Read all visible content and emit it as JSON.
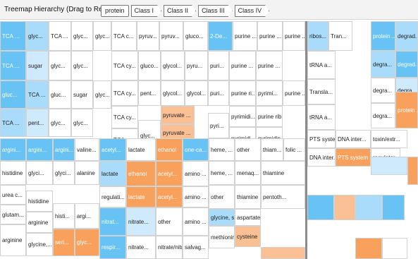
{
  "header": {
    "title": "Treemap Hierarchy (Drag to Reorder)",
    "breadcrumbs": [
      "protein",
      "Class I",
      "Class II",
      "Class III",
      "Class IV"
    ]
  },
  "treemap": {
    "cells": [
      {
        "label": "TCA ...",
        "c": "b1"
      },
      {
        "label": "glyc...",
        "c": "b2"
      },
      {
        "label": "TCA ...",
        "c": "w"
      },
      {
        "label": "glyc...",
        "c": "w"
      },
      {
        "label": "glyc...",
        "c": "w"
      },
      {
        "label": "TCA c...",
        "c": "w"
      },
      {
        "label": "pyruv...",
        "c": "w"
      },
      {
        "label": "pyruv...",
        "c": "w"
      },
      {
        "label": "gluco...",
        "c": "w"
      },
      {
        "label": "2-De...",
        "c": "b1"
      },
      {
        "label": "purine ...",
        "c": "w"
      },
      {
        "label": "purine ...",
        "c": "w"
      },
      {
        "label": "purine ...",
        "c": "w"
      },
      {
        "label": "ribos...",
        "c": "b2"
      },
      {
        "label": "Tran...",
        "c": "w"
      },
      {
        "label": "protein ...",
        "c": "b1"
      },
      {
        "label": "degrad...",
        "c": "b2"
      },
      {
        "label": "TCA ...",
        "c": "b1"
      },
      {
        "label": "sugar",
        "c": "b3"
      },
      {
        "label": "glyc...",
        "c": "w"
      },
      {
        "label": "glyc...",
        "c": "w"
      },
      {
        "label": "TCA cy...",
        "c": "w"
      },
      {
        "label": "gluco...",
        "c": "w"
      },
      {
        "label": "glycol...",
        "c": "w"
      },
      {
        "label": "pyru...",
        "c": "w"
      },
      {
        "label": "puri...",
        "c": "w"
      },
      {
        "label": "purine ...",
        "c": "w"
      },
      {
        "label": "purine ...",
        "c": "w"
      },
      {
        "label": "tRNA a...",
        "c": "w"
      },
      {
        "label": "degra...",
        "c": "b2"
      },
      {
        "label": "degrad...",
        "c": "b1"
      },
      {
        "label": "gluc...",
        "c": "b1"
      },
      {
        "label": "TCA ...",
        "c": "b2"
      },
      {
        "label": "gluc...",
        "c": "w"
      },
      {
        "label": "sugar",
        "c": "w"
      },
      {
        "label": "glyc...",
        "c": "w"
      },
      {
        "label": "TCA cy...",
        "c": "w"
      },
      {
        "label": "pent...",
        "c": "w"
      },
      {
        "label": "glycol...",
        "c": "w"
      },
      {
        "label": "glycol...",
        "c": "w"
      },
      {
        "label": "puri...",
        "c": "w"
      },
      {
        "label": "purine ri...",
        "c": "w"
      },
      {
        "label": "pyrimi...",
        "c": "w"
      },
      {
        "label": "purine ...",
        "c": "w"
      },
      {
        "label": "Transla...",
        "c": "w"
      },
      {
        "label": "degra...",
        "c": "w"
      },
      {
        "label": "degra...",
        "c": "b3"
      },
      {
        "label": "TCA ...",
        "c": "b2"
      },
      {
        "label": "pent...",
        "c": "b3"
      },
      {
        "label": "glyc...",
        "c": "w"
      },
      {
        "label": "glyc...",
        "c": "w"
      },
      {
        "label": "TCA cy...",
        "c": "w"
      },
      {
        "label": "pyruvate ...",
        "c": "o2"
      },
      {
        "label": "pyrimidi...",
        "c": "w"
      },
      {
        "label": "purine rib...",
        "c": "w"
      },
      {
        "label": "tRNA a...",
        "c": "w"
      },
      {
        "label": "degra...",
        "c": "w"
      },
      {
        "label": "protein ...",
        "c": "o1"
      },
      {
        "label": "TCA cy...",
        "c": "w"
      },
      {
        "label": "glyc...",
        "c": "w"
      },
      {
        "label": "pyruvate ...",
        "c": "o2"
      },
      {
        "label": "pyri...",
        "c": "w"
      },
      {
        "label": "pyrimidi...",
        "c": "w"
      },
      {
        "label": "pyrimidin...",
        "c": "w"
      },
      {
        "label": "PTS system",
        "c": "w"
      },
      {
        "label": "DNA inter...",
        "c": "w"
      },
      {
        "label": "toxin/extr...",
        "c": "w"
      },
      {
        "label": "argini...",
        "c": "b1"
      },
      {
        "label": "argini...",
        "c": "b1"
      },
      {
        "label": "argini...",
        "c": "b1"
      },
      {
        "label": "valine...",
        "c": "w"
      },
      {
        "label": "acetyl...",
        "c": "b1"
      },
      {
        "label": "lactate",
        "c": "w"
      },
      {
        "label": "ethanol",
        "c": "o1"
      },
      {
        "label": "one-ca...",
        "c": "b1"
      },
      {
        "label": "heme, ...",
        "c": "w"
      },
      {
        "label": "other",
        "c": "w"
      },
      {
        "label": "thiam...",
        "c": "w"
      },
      {
        "label": "folic ...",
        "c": "w"
      },
      {
        "label": "DNA inter...",
        "c": "w"
      },
      {
        "label": "PTS system",
        "c": "o1"
      },
      {
        "label": "regulator",
        "c": "w"
      },
      {
        "label": "histidine",
        "c": "w"
      },
      {
        "label": "glyci...",
        "c": "w"
      },
      {
        "label": "glyci...",
        "c": "w"
      },
      {
        "label": "alanine",
        "c": "w"
      },
      {
        "label": "lactate",
        "c": "b2"
      },
      {
        "label": "ethanol",
        "c": "o1"
      },
      {
        "label": "acetyl...",
        "c": "o1"
      },
      {
        "label": "amino ...",
        "c": "w"
      },
      {
        "label": "heme, ...",
        "c": "w"
      },
      {
        "label": "menaq...",
        "c": "w"
      },
      {
        "label": "thiamine",
        "c": "w"
      },
      {
        "label": "regulati...",
        "c": "w"
      },
      {
        "label": "lactate",
        "c": "o1"
      },
      {
        "label": "acetyl...",
        "c": "o1"
      },
      {
        "label": "amino ...",
        "c": "w"
      },
      {
        "label": "other",
        "c": "w"
      },
      {
        "label": "thiamine",
        "c": "w"
      },
      {
        "label": "pentoth...",
        "c": "w"
      },
      {
        "label": "urea c...",
        "c": "w"
      },
      {
        "label": "histidine",
        "c": "w"
      },
      {
        "label": "histi...",
        "c": "w"
      },
      {
        "label": "argi...",
        "c": "w"
      },
      {
        "label": "glutam...",
        "c": "w"
      },
      {
        "label": "arginine",
        "c": "w"
      },
      {
        "label": "nitrat...",
        "c": "b1"
      },
      {
        "label": "nitrate...",
        "c": "b3"
      },
      {
        "label": "other",
        "c": "w"
      },
      {
        "label": "amino ...",
        "c": "w"
      },
      {
        "label": "glycine, s...",
        "c": "b2"
      },
      {
        "label": "aspartate...",
        "c": "w"
      },
      {
        "label": "arginine",
        "c": "w"
      },
      {
        "label": "glycine,...",
        "c": "w"
      },
      {
        "label": "seri...",
        "c": "o1"
      },
      {
        "label": "glyc...",
        "c": "o1"
      },
      {
        "label": "respir...",
        "c": "b1"
      },
      {
        "label": "nitrate...",
        "c": "w"
      },
      {
        "label": "nitrate/nitri...",
        "c": "w"
      },
      {
        "label": "salvag...",
        "c": "w"
      },
      {
        "label": "methionine",
        "c": "w"
      },
      {
        "label": "cysteine",
        "c": "o2"
      },
      {
        "label": "",
        "c": "b1"
      },
      {
        "label": "",
        "c": "o2"
      },
      {
        "label": "",
        "c": "o1"
      },
      {
        "label": "",
        "c": "b2"
      },
      {
        "label": "",
        "c": "b1"
      },
      {
        "label": "",
        "c": "o1"
      },
      {
        "label": "",
        "c": "w"
      },
      {
        "label": "",
        "c": "b3"
      },
      {
        "label": "",
        "c": "o2"
      }
    ]
  }
}
